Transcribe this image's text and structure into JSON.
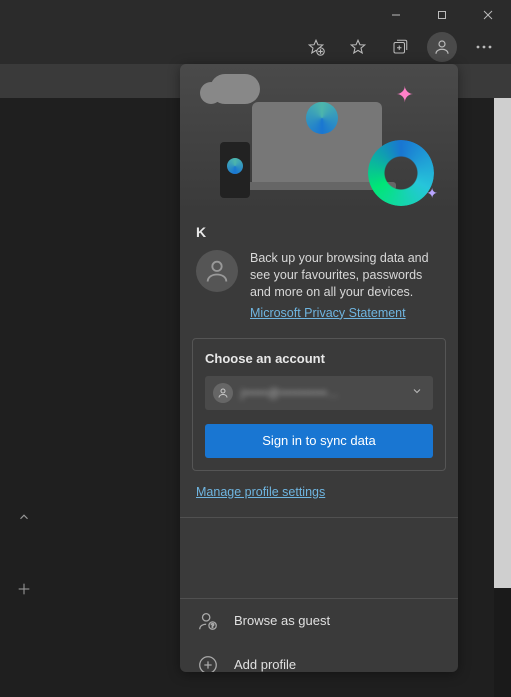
{
  "window": {
    "minimize": "—",
    "maximize": "▢",
    "close": "✕"
  },
  "flyout": {
    "profile_name": "K",
    "backup_text": "Back up your browsing data and see your favourites, passwords and more on all your devices.",
    "privacy_link": "Microsoft Privacy Statement",
    "choose_title": "Choose an account",
    "account_email": "j•••••@••••••••••...",
    "signin_label": "Sign in to sync data",
    "manage_link": "Manage profile settings",
    "browse_guest": "Browse as guest",
    "add_profile": "Add profile"
  }
}
